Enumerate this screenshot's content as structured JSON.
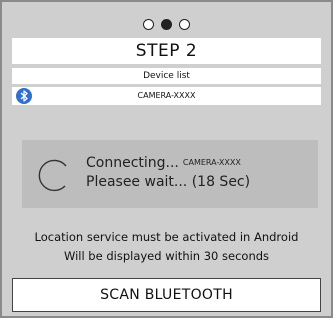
{
  "pager": {
    "total": 3,
    "current_index": 2
  },
  "step_title": "STEP 2",
  "device_list": {
    "header": "Device list",
    "items": [
      {
        "icon": "bluetooth-icon",
        "name": "CAMERA-XXXX"
      }
    ]
  },
  "connecting": {
    "status": "Connecting...",
    "device": "CAMERA-XXXX",
    "wait_text": "Pleasee wait... (18 Sec)"
  },
  "info": {
    "line1": "Location service must be activated in Android",
    "line2": "Will be displayed within 30 seconds"
  },
  "scan_button_label": "SCAN BLUETOOTH",
  "colors": {
    "background": "#cfcfcf",
    "panel": "#ffffff",
    "connecting_box": "#bdbdbd",
    "bluetooth_accent": "#2f6fce"
  }
}
